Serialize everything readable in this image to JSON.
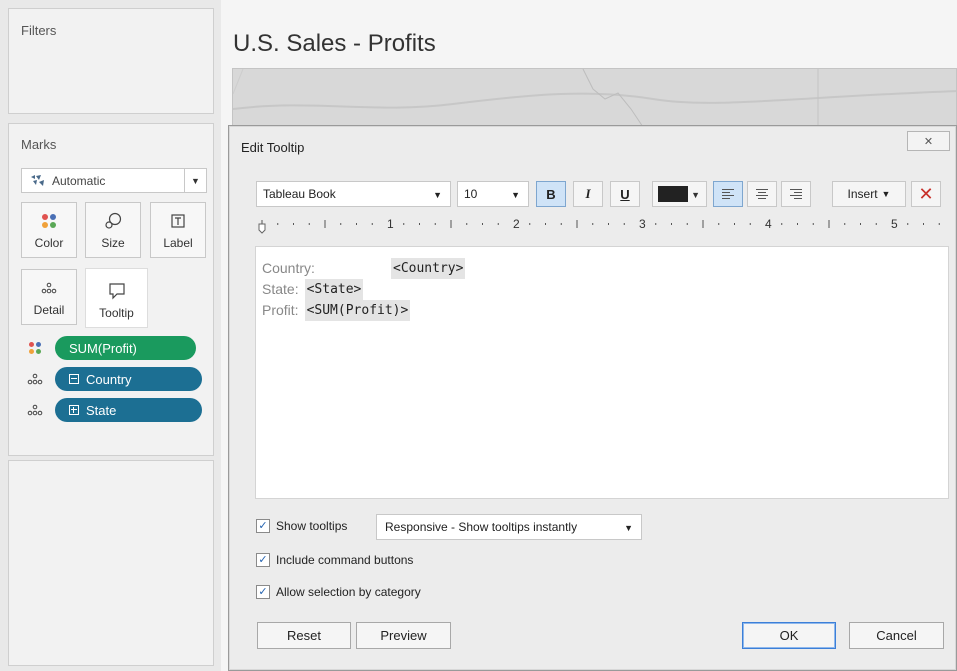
{
  "left_pane": {
    "filters_title": "Filters",
    "marks_title": "Marks",
    "mark_type": "Automatic",
    "cards": {
      "color": "Color",
      "size": "Size",
      "label": "Label",
      "detail": "Detail",
      "tooltip": "Tooltip"
    },
    "pills": [
      {
        "label": "SUM(Profit)",
        "icon": "color-dots-icon",
        "color": "#1a9a5e"
      },
      {
        "label": "Country",
        "icon": "detail-icon",
        "color": "#1c6f93"
      },
      {
        "label": "State",
        "icon": "detail-icon",
        "color": "#1c6f93"
      }
    ]
  },
  "sheet": {
    "title": "U.S. Sales - Profits"
  },
  "dialog": {
    "title": "Edit Tooltip",
    "toolbar": {
      "font": "Tableau Book",
      "size": "10",
      "bold": "B",
      "italic": "I",
      "underline": "U",
      "text_color": "#222222",
      "insert": "Insert"
    },
    "ruler_labels": [
      "1",
      "2",
      "3",
      "4",
      "5"
    ],
    "editor_lines": [
      {
        "label": "Country:",
        "field": "<Country>"
      },
      {
        "label": "State:",
        "field": "<State>"
      },
      {
        "label": "Profit:",
        "field": "<SUM(Profit)>"
      }
    ],
    "options": {
      "show_tooltips": "Show tooltips",
      "tooltip_mode": "Responsive - Show tooltips instantly",
      "include_command_buttons": "Include command buttons",
      "allow_selection": "Allow selection by category"
    },
    "buttons": {
      "reset": "Reset",
      "preview": "Preview",
      "ok": "OK",
      "cancel": "Cancel"
    }
  }
}
